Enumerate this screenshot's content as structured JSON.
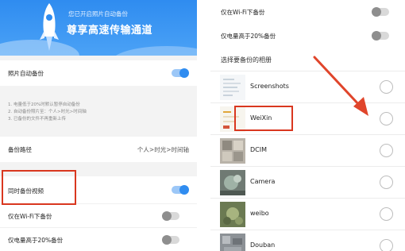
{
  "left": {
    "banner": {
      "subtitle": "您已开启照片自动备份",
      "title": "尊享高速传输通道"
    },
    "auto_backup": {
      "label": "照片自动备份",
      "enabled": true
    },
    "notes": [
      "1. 电量低于20%时默认暂停自动备份",
      "2. 自动备份照片至：个人>时光>时间轴",
      "3. 已备份的文件不再重新上传"
    ],
    "backup_path": {
      "label": "备份路径",
      "value": "个人>时光>时间轴"
    },
    "backup_video": {
      "label": "同时备份视频",
      "enabled": true
    },
    "wifi_only": {
      "label": "仅在Wi-Fi下备份",
      "enabled": false
    },
    "battery": {
      "label": "仅电量高于20%备份",
      "enabled": false
    }
  },
  "right": {
    "wifi_only": {
      "label": "仅在Wi-Fi下备份",
      "enabled": false
    },
    "battery": {
      "label": "仅电量高于20%备份",
      "enabled": false
    },
    "section_title": "选择要备份的相册",
    "albums": [
      {
        "name": "Screenshots",
        "selected": false
      },
      {
        "name": "WeiXin",
        "selected": false
      },
      {
        "name": "DCIM",
        "selected": false
      },
      {
        "name": "Camera",
        "selected": false
      },
      {
        "name": "weibo",
        "selected": false
      },
      {
        "name": "Douban",
        "selected": false
      }
    ]
  },
  "colors": {
    "accent": "#2f8cf0",
    "highlight": "#d9371f"
  }
}
